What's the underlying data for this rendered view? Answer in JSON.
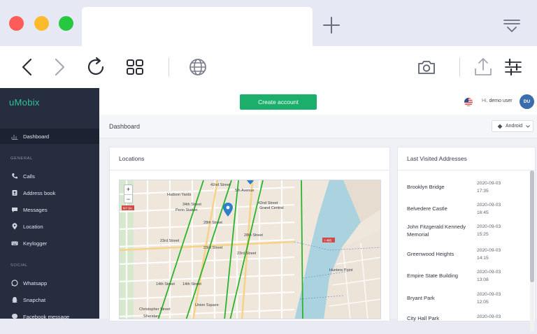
{
  "browser": {
    "window_buttons": [
      "close",
      "minimize",
      "maximize"
    ],
    "toolbar_icons": [
      "back-arrow-icon",
      "forward-arrow-icon",
      "reload-icon",
      "tabs-grid-icon",
      "globe-icon",
      "camera-icon",
      "share-icon",
      "settings-sliders-icon"
    ]
  },
  "sidebar": {
    "brand": "uMobix",
    "items_top": [
      {
        "label": "Dashboard",
        "icon": "chart-icon"
      }
    ],
    "section_general": "GENERAL",
    "items_general": [
      {
        "label": "Calls",
        "icon": "phone-icon"
      },
      {
        "label": "Address book",
        "icon": "contact-icon"
      },
      {
        "label": "Messages",
        "icon": "chat-icon"
      },
      {
        "label": "Location",
        "icon": "pin-icon"
      },
      {
        "label": "Keylogger",
        "icon": "keyboard-icon"
      }
    ],
    "section_social": "SOCIAL",
    "items_social": [
      {
        "label": "Whatsapp",
        "icon": "whatsapp-icon"
      },
      {
        "label": "Snapchat",
        "icon": "snapchat-icon"
      },
      {
        "label": "Facebook message",
        "icon": "facebook-icon"
      }
    ]
  },
  "topbar": {
    "create_account": "Create account",
    "greeting_hi": "Hi,",
    "greeting_user": "demo user",
    "avatar_initials": "DU"
  },
  "breadcrumb": "Dashboard",
  "device_select": "Android",
  "locations_card": {
    "title": "Locations",
    "map_labels": [
      "42nd Street",
      "5th Avenue",
      "42nd Street",
      "Grand Central",
      "Hudson Yards",
      "34th Street",
      "Penn Station",
      "28th Street",
      "28th Street",
      "23rd Street",
      "23rd Street",
      "23rd Street",
      "14th Street",
      "14th Street",
      "Union Square",
      "Christopher Street",
      "Sheridan",
      "NY 9A",
      "I 495",
      "Hunters Point"
    ]
  },
  "last_visited": {
    "title": "Last Visited Addresses",
    "rows": [
      {
        "name": "Brooklyn Bridge",
        "date": "2020-09-03",
        "time": "17:35"
      },
      {
        "name": "Belvedere Castle",
        "date": "2020-09-03",
        "time": "16:45"
      },
      {
        "name": "John Fitzgerald Kennedy Memorial",
        "date": "2020-09-03",
        "time": "15:25"
      },
      {
        "name": "Greenwood Heights",
        "date": "2020-09-03",
        "time": "14:15"
      },
      {
        "name": "Empire State Building",
        "date": "2020-09-03",
        "time": "13:08"
      },
      {
        "name": "Bryant Park",
        "date": "2020-09-03",
        "time": "12:05"
      },
      {
        "name": "City Hall Park",
        "date": "2020-09-03",
        "time": ""
      }
    ]
  },
  "colors": {
    "sidebar_bg": "#252d3f",
    "brand": "#2ec39a",
    "create_button": "#1cae6b",
    "avatar": "#3b6cab",
    "map_route": "#2bb32b",
    "map_pin": "#2f7fc8"
  }
}
